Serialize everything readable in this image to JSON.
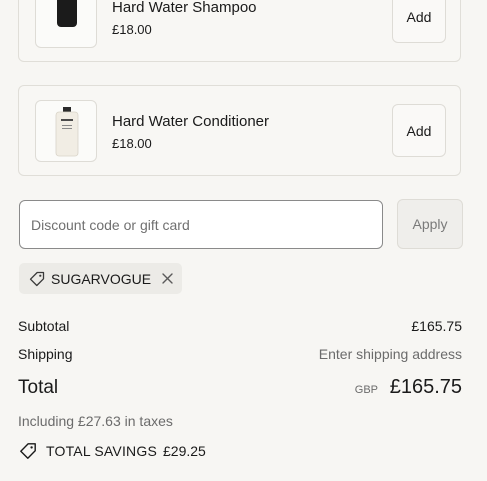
{
  "line_items": [
    {
      "name": "Hard Water Shampoo",
      "price": "£18.00",
      "add_label": "Add",
      "image": "black-shampoo-bottle"
    },
    {
      "name": "Hard Water Conditioner",
      "price": "£18.00",
      "add_label": "Add",
      "image": "white-conditioner-bottle"
    }
  ],
  "discount": {
    "placeholder": "Discount code or gift card",
    "apply_label": "Apply",
    "applied_code": "SUGARVOGUE",
    "tag_icon": "tag-icon",
    "remove_icon": "close-icon"
  },
  "summary": {
    "subtotal_label": "Subtotal",
    "subtotal_value": "£165.75",
    "shipping_label": "Shipping",
    "shipping_value": "Enter shipping address",
    "total_label": "Total",
    "currency": "GBP",
    "total_value": "£165.75",
    "taxes_note": "Including £27.63 in taxes",
    "savings_icon": "tag-icon",
    "savings_label": "TOTAL SAVINGS",
    "savings_value": "£29.25"
  },
  "colors": {
    "background": "#f7f6f3",
    "border": "#e0ded8",
    "muted_text": "#6b6b6b",
    "chip_bg": "#ecebe7"
  }
}
